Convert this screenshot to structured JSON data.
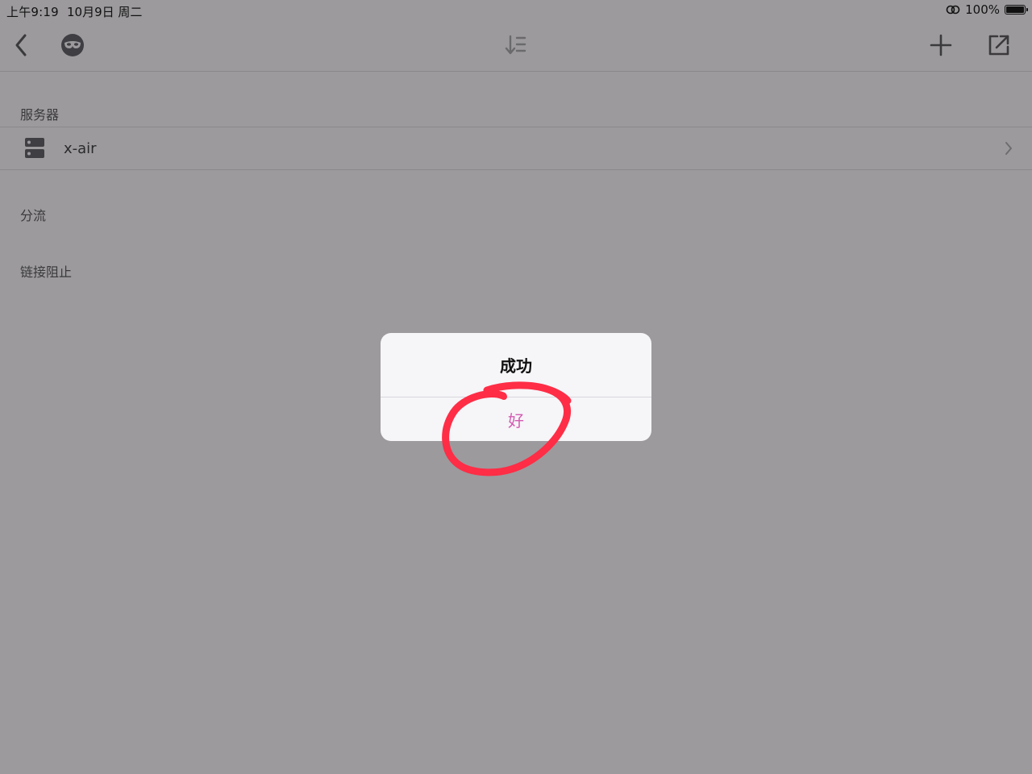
{
  "status_bar": {
    "time": "上午9:19",
    "date": "10月9日 周二",
    "battery": "100%"
  },
  "nav": {
    "back_icon": "chevron-left-icon",
    "mask_icon": "incognito-mask-icon",
    "sort_icon": "sort-icon",
    "add_icon": "plus-icon",
    "share_icon": "external-link-icon"
  },
  "sections": {
    "servers_header": "服务器",
    "server_name": "x-air",
    "routing_header": "分流",
    "blocking_header": "链接阻止"
  },
  "alert": {
    "title": "成功",
    "ok_label": "好",
    "ok_color": "#d45bb3"
  },
  "annotation": {
    "color": "#ff2d46"
  }
}
